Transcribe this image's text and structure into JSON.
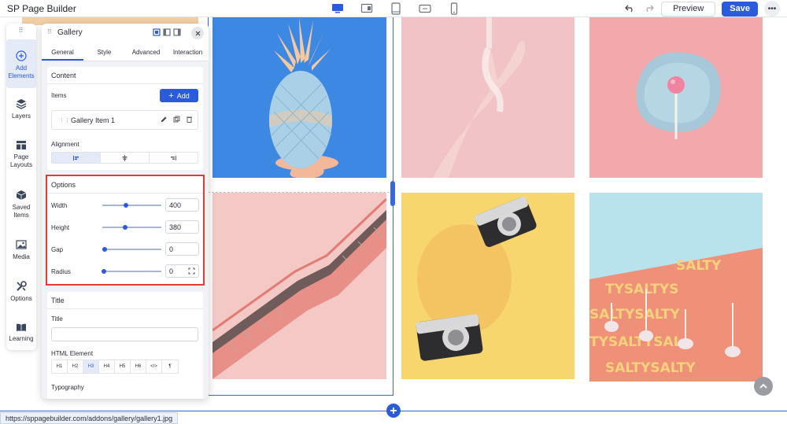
{
  "app": {
    "title": "SP Page Builder"
  },
  "toolbar": {
    "preview_label": "Preview",
    "save_label": "Save",
    "more_label": "•••"
  },
  "rail": {
    "grip": "⠿",
    "items": [
      {
        "line1": "Add",
        "line2": "Elements",
        "icon": "plus-circle-icon"
      },
      {
        "line1": "Layers",
        "line2": "",
        "icon": "layers-icon"
      },
      {
        "line1": "Page",
        "line2": "Layouts",
        "icon": "layout-icon"
      },
      {
        "line1": "Saved",
        "line2": "Items",
        "icon": "cube-icon"
      },
      {
        "line1": "Media",
        "line2": "",
        "icon": "media-icon"
      },
      {
        "line1": "Options",
        "line2": "",
        "icon": "wrench-icon"
      },
      {
        "line1": "Learning",
        "line2": "",
        "icon": "book-icon"
      }
    ]
  },
  "panel": {
    "grip": "⠿",
    "title": "Gallery",
    "tabs": [
      "General",
      "Style",
      "Advanced",
      "Interaction"
    ],
    "content": {
      "heading": "Content",
      "items_label": "Items",
      "add_label": "Add",
      "add_plus": "+",
      "item_name": "Gallery Item 1",
      "alignment_label": "Alignment"
    },
    "options": {
      "heading": "Options",
      "width": {
        "label": "Width",
        "value": "400"
      },
      "height": {
        "label": "Height",
        "value": "380"
      },
      "gap": {
        "label": "Gap",
        "value": "0"
      },
      "radius": {
        "label": "Radius",
        "value": "0"
      }
    },
    "title_section": {
      "heading": "Title",
      "title_label": "Title",
      "html_element_label": "HTML Element",
      "tags": [
        "H1",
        "H2",
        "H3",
        "H4",
        "H5",
        "H6",
        "</>",
        "¶"
      ],
      "active_tag": "H3",
      "typography_label": "Typography"
    }
  },
  "status": {
    "url": "https://sppagebuilder.com/addons/gallery/gallery1.jpg"
  },
  "colors": {
    "accent": "#2a5bdc",
    "highlight": "#e23b37",
    "panel_bg": "#f1f2f6"
  }
}
